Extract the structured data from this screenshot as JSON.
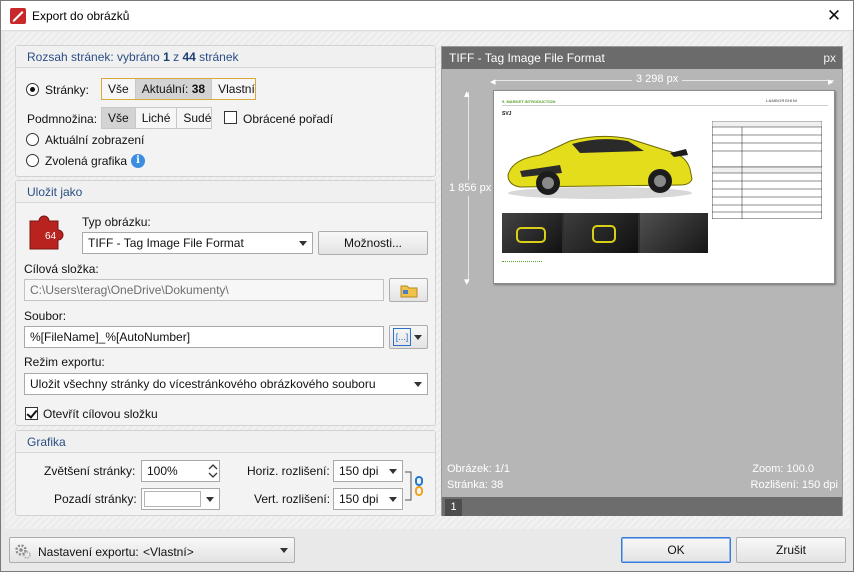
{
  "window": {
    "title": "Export do obrázků"
  },
  "page_range": {
    "heading_prefix": "Rozsah stránek: vybráno",
    "selected": "1",
    "of_word": "z",
    "total": "44",
    "pages_word": "stránek",
    "pages_label": "Stránky:",
    "pages_options": [
      "Vše",
      "Aktuální:",
      "38",
      "Vlastní"
    ],
    "subset_label": "Podmnožina:",
    "subset_options": [
      "Vše",
      "Liché",
      "Sudé"
    ],
    "reverse_label": "Obrácené pořadí",
    "current_view_label": "Aktuální zobrazení",
    "selected_graphic_label": "Zvolená grafika"
  },
  "save_as": {
    "heading": "Uložit jako",
    "image_type_label": "Typ obrázku:",
    "image_type_value": "TIFF - Tag Image File Format",
    "options_button": "Možnosti...",
    "icon_badge": "64",
    "folder_label": "Cílová složka:",
    "folder_value": "C:\\Users\\terag\\OneDrive\\Dokumenty\\",
    "file_label": "Soubor:",
    "file_value": "%[FileName]_%[AutoNumber]",
    "macro_button": "[...]",
    "mode_label": "Režim exportu:",
    "mode_value": "Uložit všechny stránky do vícestránkového obrázkového souboru",
    "open_folder_label": "Otevřít cílovou složku"
  },
  "graphics": {
    "heading": "Grafika",
    "zoom_label": "Zvětšení stránky:",
    "zoom_value": "100%",
    "background_label": "Pozadí stránky:",
    "horiz_label": "Horiz. rozlišení:",
    "horiz_value": "150 dpi",
    "vert_label": "Vert. rozlišení:",
    "vert_value": "150 dpi"
  },
  "preview": {
    "title": "TIFF - Tag Image File Format",
    "unit": "px",
    "width_text": "3 298 px",
    "height_text": "1 856 px",
    "image_label": "Obrázek: 1/1",
    "page_label": "Stránka: 38",
    "zoom_label": "Zoom: 100.0",
    "resolution_label": "Rozlišení: 150 dpi",
    "tab_number": "1",
    "thumb_heading": "5. MARKET INTRODUCTION",
    "thumb_sub": "SVJ",
    "thumb_brand": "LAMBORGHINI"
  },
  "footer": {
    "settings_label": "Nastavení exportu:",
    "settings_value": "<Vlastní>",
    "ok_button": "OK",
    "cancel_button": "Zrušit"
  },
  "colors": {
    "accent_seg_border": "#d7a83a",
    "heading_blue": "#2b4e84",
    "info_blue": "#3b8de0",
    "link_icon": "#1f78d1"
  }
}
